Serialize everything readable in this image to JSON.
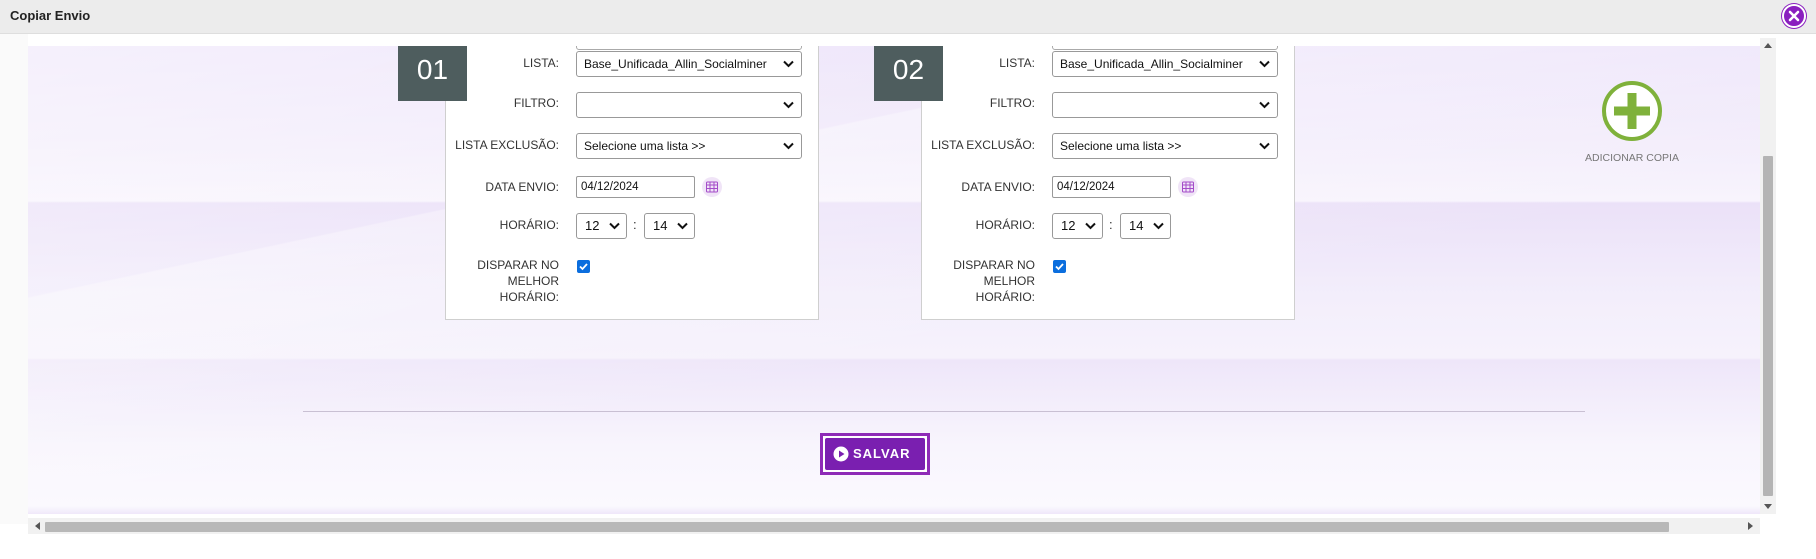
{
  "window": {
    "title": "Copiar Envio"
  },
  "copies": [
    {
      "number": "01",
      "labels": {
        "lista": "LISTA:",
        "filtro": "FILTRO:",
        "lista_exclusao": "LISTA EXCLUSÃO:",
        "data_envio": "DATA ENVIO:",
        "horario": "HORÁRIO:",
        "disparar": "DISPARAR NO MELHOR HORÁRIO:"
      },
      "lista_value": "Base_Unificada_Allin_Socialminer",
      "filtro_value": "",
      "lista_exclusao_value": "Selecione uma lista >>",
      "data_envio_value": "04/12/2024",
      "hora_value": "12",
      "minuto_value": "14",
      "colon": ":",
      "disparar_checked": true
    },
    {
      "number": "02",
      "labels": {
        "lista": "LISTA:",
        "filtro": "FILTRO:",
        "lista_exclusao": "LISTA EXCLUSÃO:",
        "data_envio": "DATA ENVIO:",
        "horario": "HORÁRIO:",
        "disparar": "DISPARAR NO MELHOR HORÁRIO:"
      },
      "lista_value": "Base_Unificada_Allin_Socialminer",
      "filtro_value": "",
      "lista_exclusao_value": "Selecione uma lista >>",
      "data_envio_value": "04/12/2024",
      "hora_value": "12",
      "minuto_value": "14",
      "colon": ":",
      "disparar_checked": true
    }
  ],
  "add_copy": {
    "label": "ADICIONAR COPIA",
    "icon": "plus-circle-icon",
    "color": "#7fb13b"
  },
  "save": {
    "label": "SALVAR",
    "icon": "play-circle-icon",
    "color": "#7a1fb0"
  },
  "icons": {
    "close": "close-icon",
    "calendar": "calendar-icon",
    "dropdown": "chevron-down-icon",
    "checkbox": "checkmark-icon"
  },
  "colors": {
    "badge": "#4e5d5e",
    "close": "#8a1fbf",
    "checkbox": "#0b6ede"
  }
}
